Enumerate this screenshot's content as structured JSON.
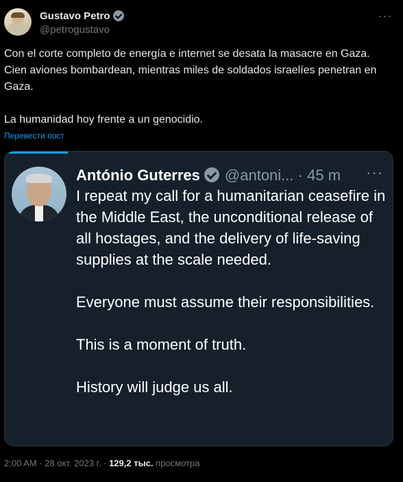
{
  "author": {
    "name": "Gustavo Petro",
    "handle": "@petrogustavo"
  },
  "tweet": {
    "text": "Con el corte completo de energía e internet se desata la masacre en Gaza. Cien aviones bombardean, mientras miles de soldados israelíes penetran en Gaza.\n\nLa humanidad hoy frente a un genocidio.",
    "translate_link": "Перевести пост"
  },
  "quoted": {
    "name": "António Guterres",
    "handle": "@antoni...",
    "separator": "·",
    "time": "45 m",
    "paragraphs": [
      "I repeat my call for a humanitarian ceasefire in the Middle East, the unconditional release of all hostages, and the delivery of life-saving supplies at the scale needed.",
      "Everyone must assume their responsibilities.",
      "This is a moment of truth.",
      "History will judge us all."
    ]
  },
  "meta": {
    "time": "2:00 AM",
    "date": "28 окт. 2023 г.",
    "views_count": "129,2 тыс.",
    "views_label": "просмотра"
  },
  "icons": {
    "verified": "verified-badge-icon",
    "more": "more-horizontal-icon"
  },
  "colors": {
    "background": "#000000",
    "text": "#e7e9ea",
    "muted": "#71767b",
    "link": "#1d9bf0",
    "quote_background": "#15202b",
    "verified_badge": "#8b98a5"
  }
}
